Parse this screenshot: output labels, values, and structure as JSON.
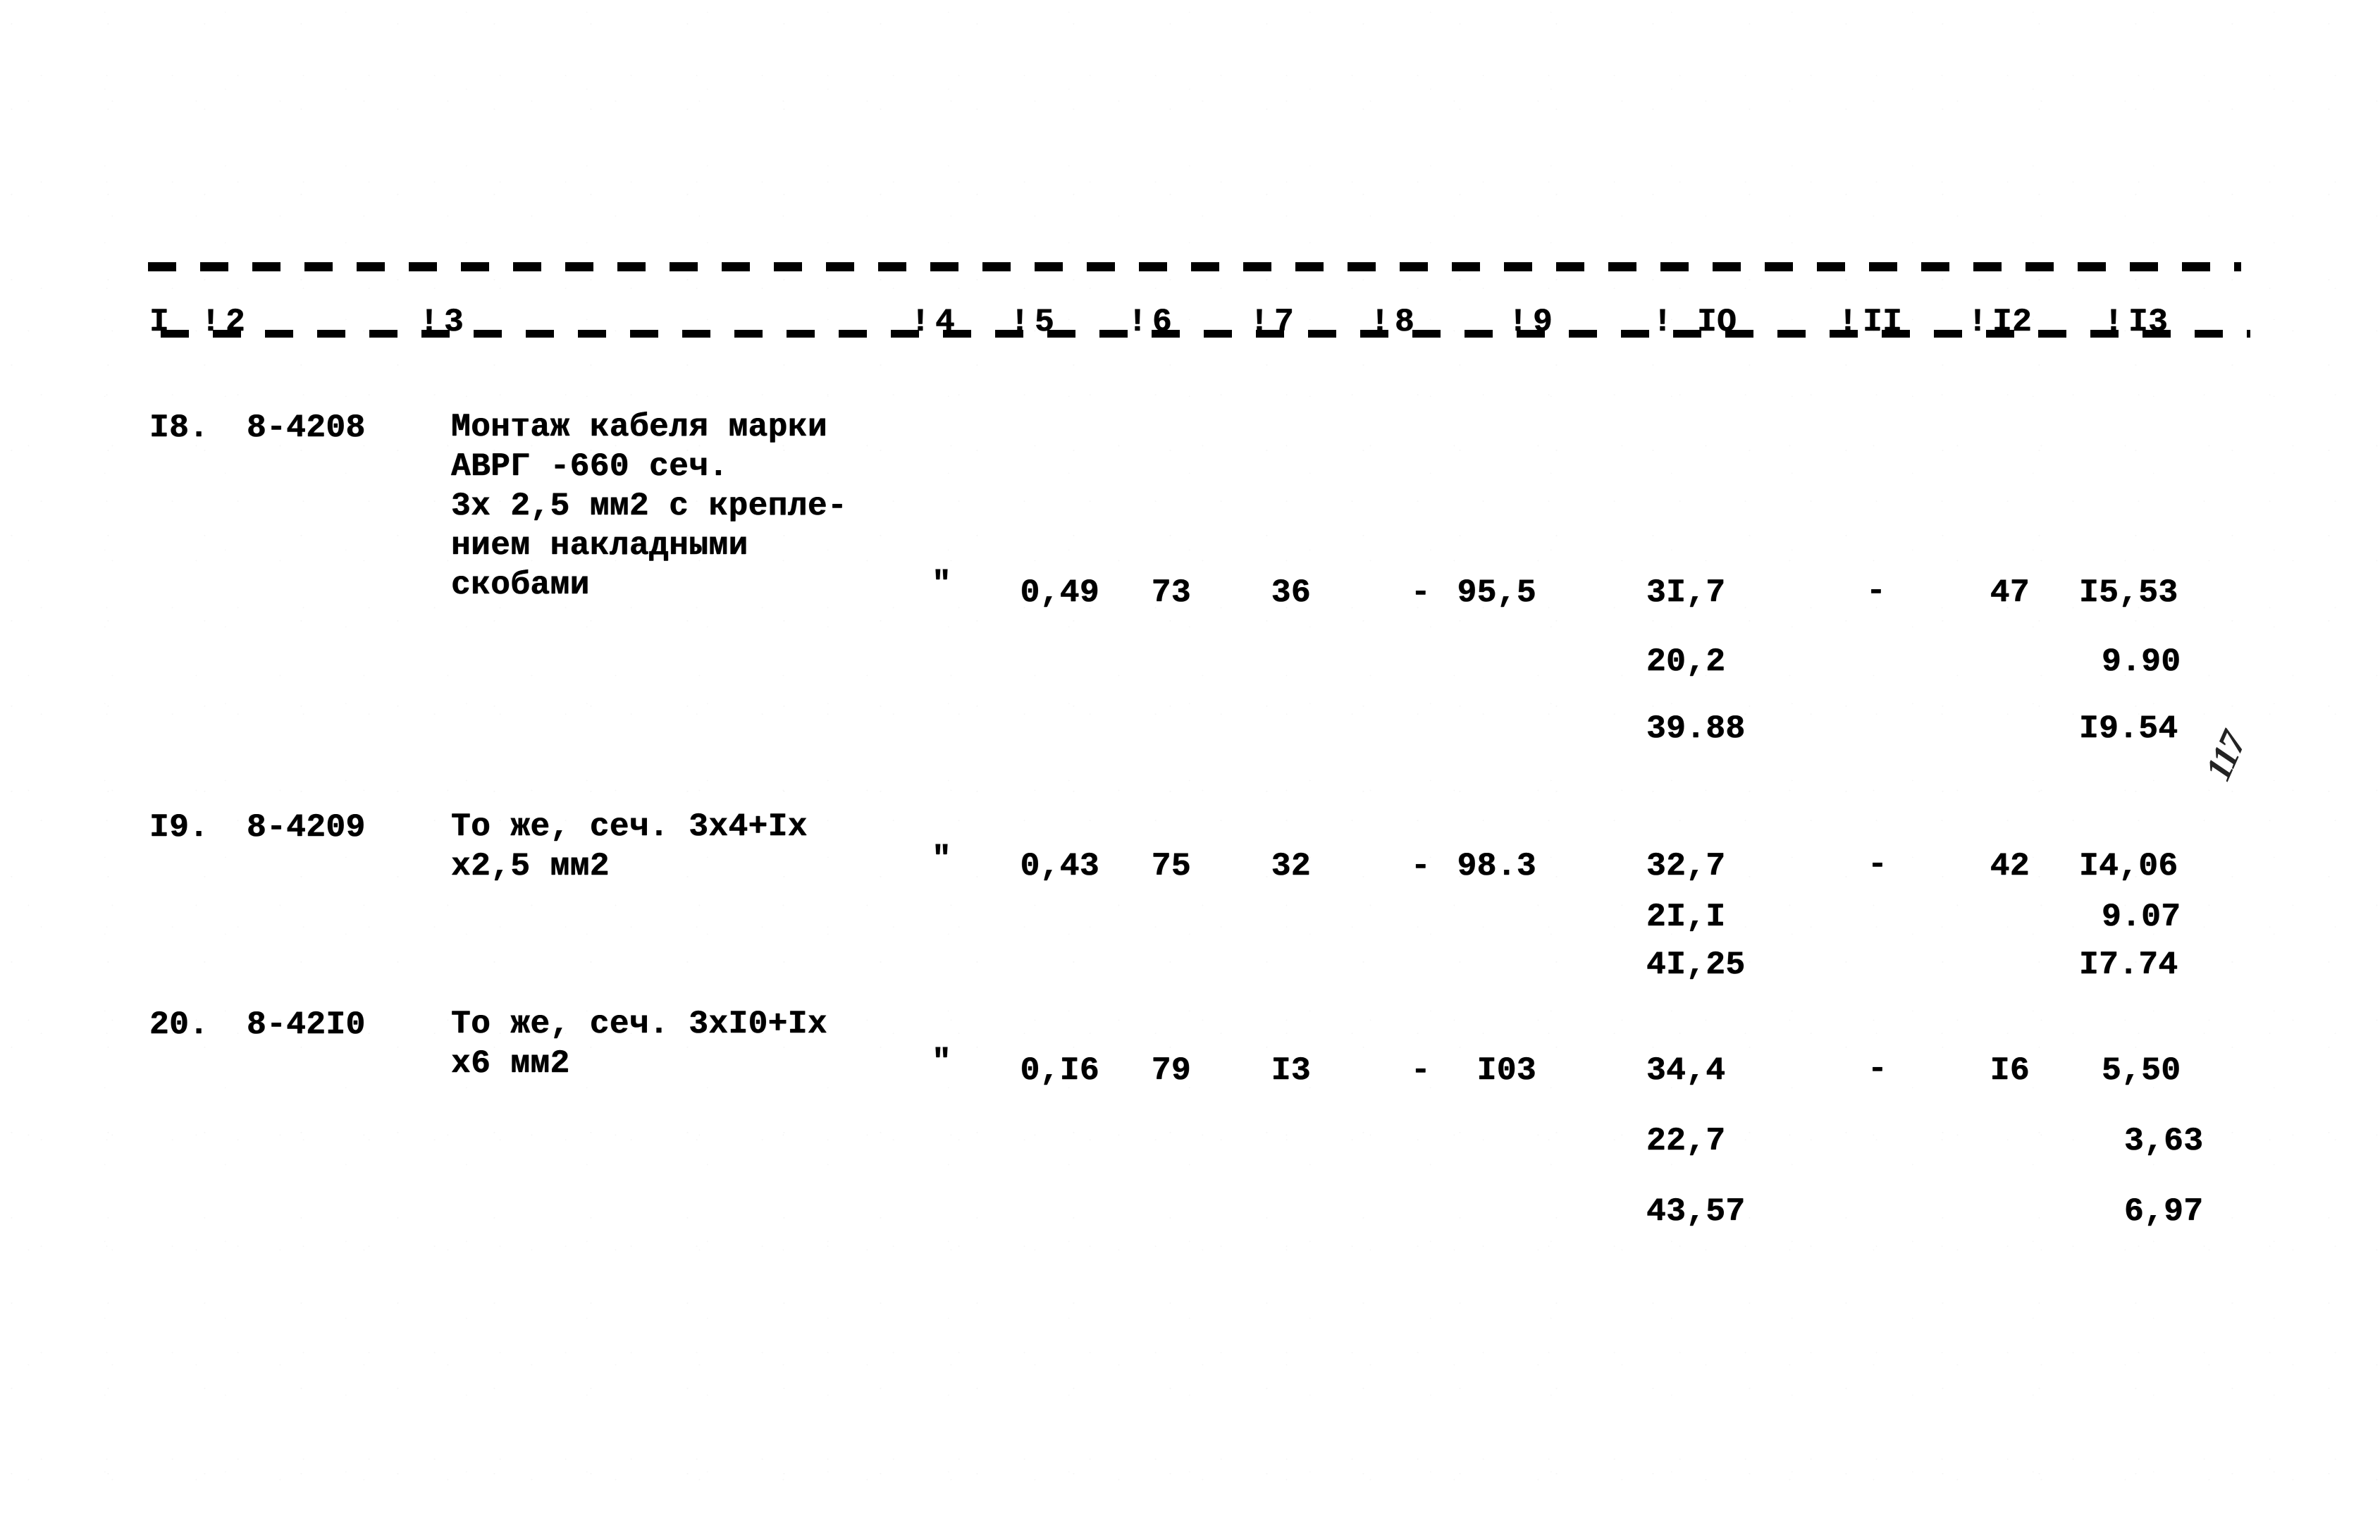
{
  "document": {
    "type": "typewritten-price-table",
    "folio": "117",
    "background_hex": "#ffffff",
    "ink_hex": "#000000"
  },
  "table": {
    "column_header_numbers": [
      "I",
      "2",
      "3",
      "4",
      "5",
      "6",
      "7",
      "8",
      "9",
      "IO",
      "II",
      "I2",
      "I3"
    ],
    "column_separator_glyph": "!",
    "rows": [
      {
        "col1_index": "I8.",
        "col2_code": "8-4208",
        "col3_description_lines": [
          "Монтаж кабеля марки",
          "АВРГ -660 сеч.",
          "3х 2,5 мм2 с крепле-",
          "нием накладными",
          "скобами"
        ],
        "col4_unit": "\"",
        "col5": "0,49",
        "col6": "73",
        "col7": "36",
        "col8": "-",
        "col9": "95,5",
        "col10_main": "3I,7",
        "col10_sub1": "20,2",
        "col10_sub2": "39.88",
        "col11": "-",
        "col12": "47",
        "col13_main": "I5,53",
        "col13_sub1": "9.90",
        "col13_sub2": "I9.54"
      },
      {
        "col1_index": "I9.",
        "col2_code": "8-4209",
        "col3_description_lines": [
          "То же, сеч. 3х4+Iх",
          "х2,5 мм2"
        ],
        "col4_unit": "\"",
        "col5": "0,43",
        "col6": "75",
        "col7": "32",
        "col8": "-",
        "col9": "98.3",
        "col10_main": "32,7",
        "col10_sub1": "2I,I",
        "col10_sub2": "4I,25",
        "col11": "-",
        "col12": "42",
        "col13_main": "I4,06",
        "col13_sub1": "9.07",
        "col13_sub2": "I7.74"
      },
      {
        "col1_index": "20.",
        "col2_code": "8-42I0",
        "col3_description_lines": [
          "То же, сеч. 3хI0+Iх",
          "х6 мм2"
        ],
        "col4_unit": "\"",
        "col5": "0,I6",
        "col6": "79",
        "col7": "I3",
        "col8": "-",
        "col9": "I03",
        "col10_main": "34,4",
        "col10_sub1": "22,7",
        "col10_sub2": "43,57",
        "col11": "-",
        "col12": "I6",
        "col13_main": "5,50",
        "col13_sub1": "3,63",
        "col13_sub2": "6,97"
      }
    ]
  }
}
